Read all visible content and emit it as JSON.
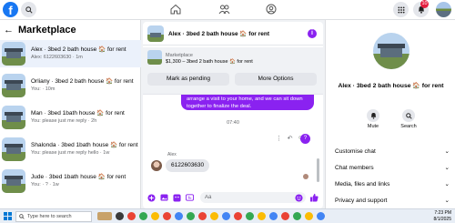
{
  "topbar": {
    "logo_letter": "f",
    "notifications_count": "10"
  },
  "sidebar": {
    "title": "Marketplace",
    "conversations": [
      {
        "title": "Alex · 3bed 2 bath house 🏠 for rent",
        "preview": "Alex: 6122603630 · 1m",
        "active": true
      },
      {
        "title": "Orliany · 3bed 2 bath house 🏠 for rent",
        "preview": "You: · 10m",
        "active": false
      },
      {
        "title": "Man · 3bed 1bath house 🏠 for rent",
        "preview": "You: please just me reply · 2h",
        "active": false
      },
      {
        "title": "Shalonda · 3bed 1bath house 🏠 for rent",
        "preview": "You: please just me reply hello · 1w",
        "active": false
      },
      {
        "title": "Jude · 3bed 1bath house 🏠 for rent",
        "preview": "You: · ? · 1w",
        "active": false
      }
    ]
  },
  "chat": {
    "title": "Alex · 3bed 2 bath house 🏠 for rent",
    "listing_label": "Marketplace",
    "listing_price": "$1,300 – 3bed 2 bath house 🏠 for rent",
    "mark_pending_label": "Mark as pending",
    "more_options_label": "More Options",
    "outgoing_message": "arrange a visit to your home, and we can sit down together to finalize the deal.",
    "time_divider": "07:40",
    "incoming_sender": "Alex",
    "incoming_message": "6122603630",
    "input_placeholder": "Aa"
  },
  "details": {
    "title": "Alex · 3bed 2 bath house 🏠 for rent",
    "mute_label": "Mute",
    "search_label": "Search",
    "sections": [
      "Customise chat",
      "Chat members",
      "Media, files and links",
      "Privacy and support"
    ]
  },
  "taskbar": {
    "search_placeholder": "Type here to search",
    "time": "7:23 PM",
    "date": "8/1/2025"
  },
  "colors": {
    "accent": "#8a22f0",
    "facebook_blue": "#1877f2"
  }
}
